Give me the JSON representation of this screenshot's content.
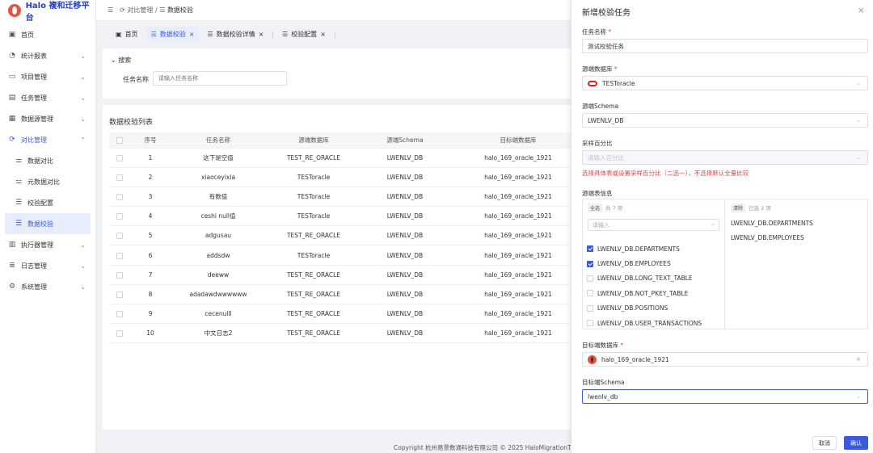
{
  "app": {
    "title": "Halo 複和迁移平台"
  },
  "sidebar": {
    "items": [
      {
        "label": "首页",
        "icon": "monitor-icon"
      },
      {
        "label": "统计报表",
        "icon": "pie-chart-icon"
      },
      {
        "label": "项目管理",
        "icon": "folder-icon"
      },
      {
        "label": "任务管理",
        "icon": "clipboard-icon"
      },
      {
        "label": "数据源管理",
        "icon": "database-icon"
      },
      {
        "label": "对比管理",
        "icon": "sync-icon"
      }
    ],
    "submenu": [
      {
        "label": "数据对比"
      },
      {
        "label": "元数据对比"
      },
      {
        "label": "校验配置"
      },
      {
        "label": "数据校验"
      }
    ],
    "items_after": [
      {
        "label": "执行器管理"
      },
      {
        "label": "日志管理"
      },
      {
        "label": "系统管理"
      }
    ]
  },
  "header": {
    "menu_glyph": "☰",
    "breadcrumb": [
      "对比管理",
      "数据校验"
    ]
  },
  "tabs": [
    {
      "label": "首页"
    },
    {
      "label": "数据校验"
    },
    {
      "label": "数据校验详情"
    },
    {
      "label": "校验配置"
    }
  ],
  "search": {
    "toggle_label": "搜索",
    "task_name_label": "任务名称",
    "task_name_placeholder": "请输入任务名称"
  },
  "list": {
    "title": "数据校验列表",
    "columns": [
      "序号",
      "任务名称",
      "源端数据库",
      "源端Schema",
      "目标端数据库"
    ],
    "rows": [
      [
        "1",
        "这下是空值",
        "TEST_RE_ORACLE",
        "LWENLV_DB",
        "halo_169_oracle_1921"
      ],
      [
        "2",
        "xiaoceyixia",
        "TESToracle",
        "LWENLV_DB",
        "halo_169_oracle_1921"
      ],
      [
        "3",
        "有数值",
        "TESToracle",
        "LWENLV_DB",
        "halo_169_oracle_1921"
      ],
      [
        "4",
        "ceshi null值",
        "TESToracle",
        "LWENLV_DB",
        "halo_169_oracle_1921"
      ],
      [
        "5",
        "adgusau",
        "TEST_RE_ORACLE",
        "LWENLV_DB",
        "halo_169_oracle_1921"
      ],
      [
        "6",
        "addsdw",
        "TESToracle",
        "LWENLV_DB",
        "halo_169_oracle_1921"
      ],
      [
        "7",
        "deeww",
        "TEST_RE_ORACLE",
        "LWENLV_DB",
        "halo_169_oracle_1921"
      ],
      [
        "8",
        "adadawdwwwwww",
        "TEST_RE_ORACLE",
        "LWENLV_DB",
        "halo_169_oracle_1921"
      ],
      [
        "9",
        "cecenulll",
        "TEST_RE_ORACLE",
        "LWENLV_DB",
        "halo_169_oracle_1921"
      ],
      [
        "10",
        "中文日志2",
        "TEST_RE_ORACLE",
        "LWENLV_DB",
        "halo_169_oracle_1921"
      ]
    ]
  },
  "footer": {
    "text": "Copyright 杭州易景数通科技有限公司 © 2025 HaloMigrationT"
  },
  "drawer": {
    "title": "新增校验任务",
    "close_glyph": "×",
    "task_name_label": "任务名称",
    "task_name_value": "测试校验任务",
    "source_db_label": "源端数据库",
    "source_db_value": "TESToracle",
    "source_schema_label": "源端Schema",
    "source_schema_value": "LWENLV_DB",
    "sample_label": "采样百分比",
    "sample_placeholder": "请输入百分比",
    "hint": "选择具体表或设置采样百分比（二选一），不选择默认全量比较",
    "table_info_label": "源端表信息",
    "transfer_left": {
      "select_all": "全选",
      "count": "共 7 项",
      "search_placeholder": "请输入",
      "items": [
        {
          "label": "LWENLV_DB.DEPARTMENTS",
          "checked": true
        },
        {
          "label": "LWENLV_DB.EMPLOYEES",
          "checked": true
        },
        {
          "label": "LWENLV_DB.LONG_TEXT_TABLE",
          "checked": false
        },
        {
          "label": "LWENLV_DB.NOT_PKEY_TABLE",
          "checked": false
        },
        {
          "label": "LWENLV_DB.POSITIONS",
          "checked": false
        },
        {
          "label": "LWENLV_DB.USER_TRANSACTIONS",
          "checked": false
        }
      ]
    },
    "transfer_right": {
      "clear": "清除",
      "count": "已选 2 项",
      "items": [
        "LWENLV_DB.DEPARTMENTS",
        "LWENLV_DB.EMPLOYEES"
      ]
    },
    "target_db_label": "目标端数据库",
    "target_db_value": "halo_169_oracle_1921",
    "target_schema_label": "目标端Schema",
    "target_schema_value": "lwenlv_db",
    "cancel_label": "取消",
    "ok_label": "确认"
  },
  "colors": {
    "accent": "#3a5ad9",
    "danger": "#e54545",
    "active_bg": "#e8edfc"
  }
}
